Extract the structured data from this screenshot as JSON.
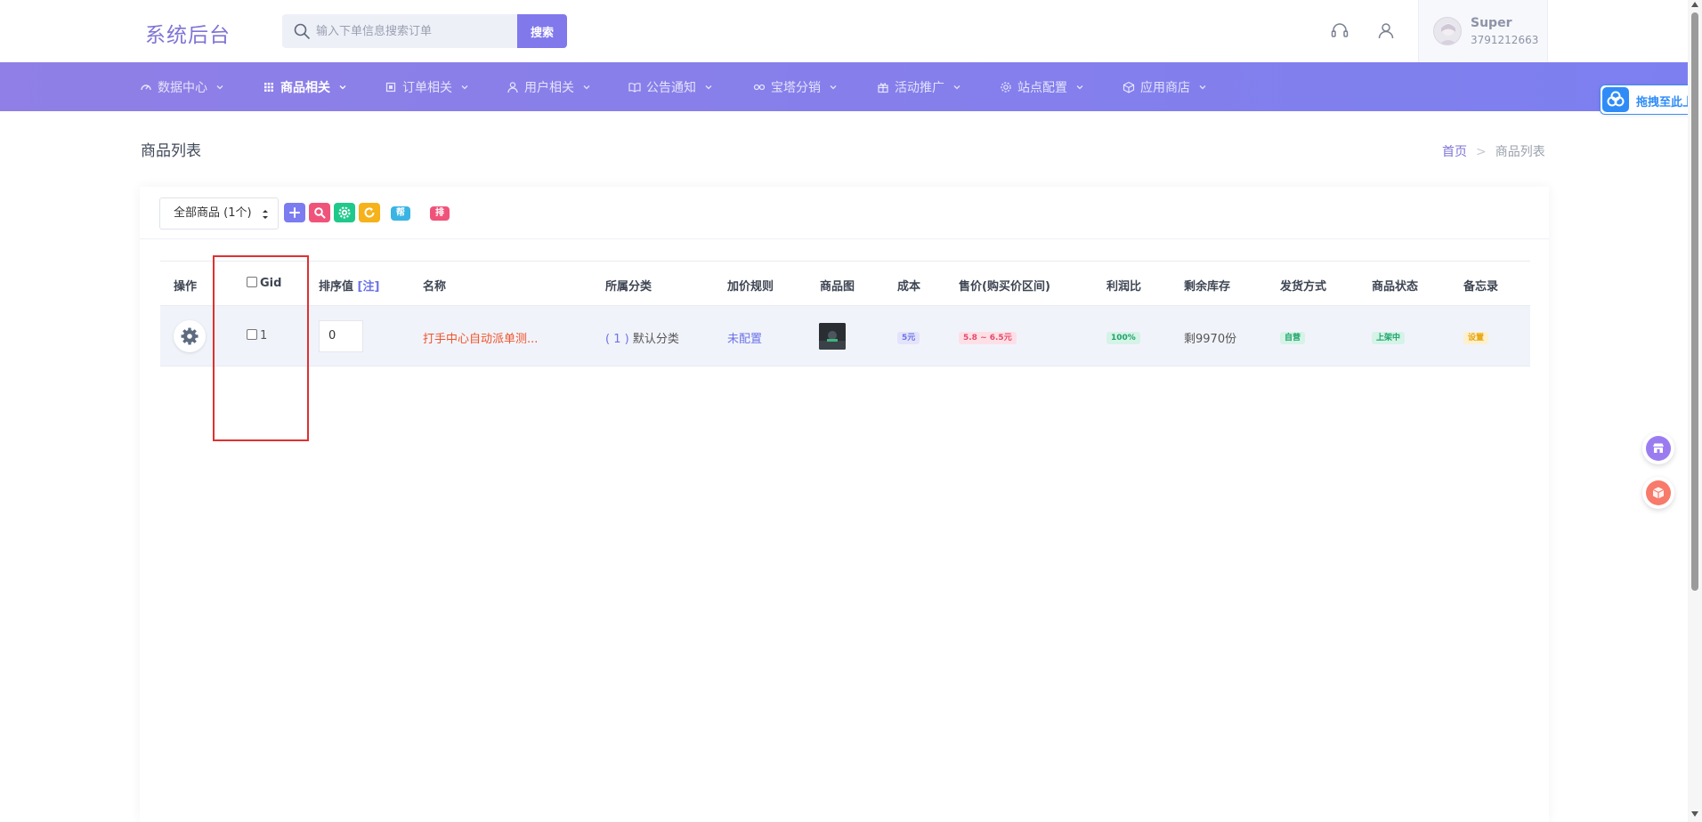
{
  "header": {
    "logo": "系统后台",
    "search_placeholder": "输入下单信息搜索订单",
    "search_button": "搜索",
    "user_name": "Super",
    "user_id": "3791212663"
  },
  "nav": [
    {
      "label": "数据中心",
      "icon": "dashboard-icon"
    },
    {
      "label": "商品相关",
      "icon": "grid-icon",
      "active": true
    },
    {
      "label": "订单相关",
      "icon": "order-icon"
    },
    {
      "label": "用户相关",
      "icon": "user-icon"
    },
    {
      "label": "公告通知",
      "icon": "book-icon"
    },
    {
      "label": "宝塔分销",
      "icon": "link-icon"
    },
    {
      "label": "活动推广",
      "icon": "gift-icon"
    },
    {
      "label": "站点配置",
      "icon": "gear-icon"
    },
    {
      "label": "应用商店",
      "icon": "box-icon"
    }
  ],
  "upload_widget": "拖拽至此上传",
  "page": {
    "title": "商品列表",
    "breadcrumb_home": "首页",
    "breadcrumb_sep": ">",
    "breadcrumb_current": "商品列表"
  },
  "toolbar": {
    "select_value": "全部商品 (1个)",
    "help_label": "帮助",
    "sort_label": "排序"
  },
  "table": {
    "headers": {
      "op": "操作",
      "gid": "Gid",
      "sort": "排序值",
      "sort_note": "[注]",
      "name": "名称",
      "category": "所属分类",
      "markup": "加价规则",
      "image": "商品图",
      "cost": "成本",
      "price": "售价(购买价区间)",
      "profit": "利润比",
      "stock": "剩余库存",
      "delivery": "发货方式",
      "status": "商品状态",
      "memo": "备忘录"
    },
    "rows": [
      {
        "gid": "1",
        "sort": "0",
        "name": "打手中心自动派单测...",
        "category_count": "( 1 )",
        "category_name": "默认分类",
        "markup": "未配置",
        "cost": "5元",
        "price": "5.8 ~ 6.5元",
        "profit": "100%",
        "stock": "剩9970份",
        "delivery": "自营",
        "status": "上架中",
        "memo": "设置"
      }
    ]
  },
  "colors": {
    "accent": "#8178ec",
    "nav_start": "#8f7fe6",
    "nav_end": "#7d7ff0",
    "name_link": "#f0542a",
    "highlight": "#e03030"
  }
}
